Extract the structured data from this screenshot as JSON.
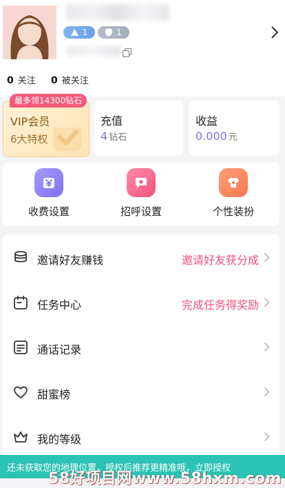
{
  "profile": {
    "level_badge_1": "1",
    "level_badge_2": "1",
    "following_count": "0",
    "following_label": "关注",
    "followers_count": "0",
    "followers_label": "被关注"
  },
  "vip": {
    "promo": "最多领14300钻石",
    "title": "VIP会员",
    "subtitle": "6大特权"
  },
  "recharge": {
    "title": "充值",
    "value": "4",
    "unit": "钻石"
  },
  "income": {
    "title": "收益",
    "value": "0.000",
    "unit": "元"
  },
  "shortcuts": [
    {
      "label": "收费设置",
      "icon": "yen-bag-icon"
    },
    {
      "label": "招呼设置",
      "icon": "chat-heart-icon"
    },
    {
      "label": "个性装扮",
      "icon": "outfit-icon"
    }
  ],
  "menu": [
    {
      "label": "邀请好友赚钱",
      "hint": "邀请好友获分成",
      "icon": "coins-stack-icon"
    },
    {
      "label": "任务中心",
      "hint": "完成任务得奖励",
      "icon": "calendar-icon"
    },
    {
      "label": "通话记录",
      "hint": "",
      "icon": "list-doc-icon"
    },
    {
      "label": "甜蜜榜",
      "hint": "",
      "icon": "heart-icon"
    },
    {
      "label": "我的等级",
      "hint": "",
      "icon": "crown-icon"
    }
  ],
  "banner": {
    "text": "还未获取您的地理位置，授权后推荐更精准哦，立即授权"
  },
  "watermark": "58好项目网www.58hxm.com",
  "colors": {
    "accent_purple": "#7c74e8",
    "accent_pink": "#f0527a",
    "banner_teal": "#2bc3b4",
    "vip_gold": "#ffe3b3"
  }
}
